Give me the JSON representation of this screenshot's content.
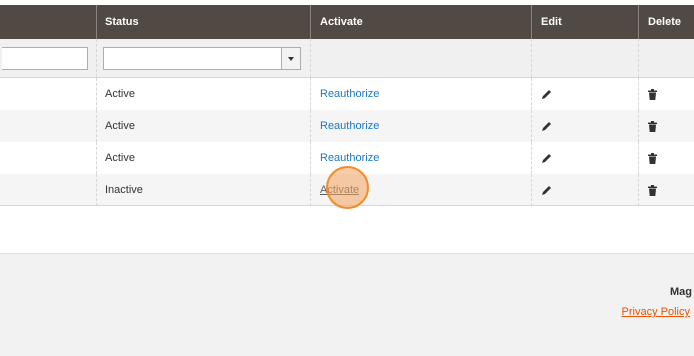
{
  "grid": {
    "columns": [
      {
        "key": "name",
        "label": ""
      },
      {
        "key": "status",
        "label": "Status"
      },
      {
        "key": "activate",
        "label": "Activate"
      },
      {
        "key": "edit",
        "label": "Edit"
      },
      {
        "key": "delete",
        "label": "Delete"
      }
    ],
    "filters": {
      "name_value": "",
      "status_selected": ""
    },
    "rows": [
      {
        "status": "Active",
        "activate": "Reauthorize"
      },
      {
        "status": "Active",
        "activate": "Reauthorize"
      },
      {
        "status": "Active",
        "activate": "Reauthorize"
      },
      {
        "status": "Inactive",
        "activate": "Activate"
      }
    ]
  },
  "footer": {
    "brand_text": "Mag",
    "privacy_link": "Privacy Policy"
  },
  "icons": {
    "edit": "pencil-icon",
    "delete": "trash-icon",
    "select_arrow": "chevron-down-icon"
  },
  "colors": {
    "header_bg": "#514943",
    "link": "#1979c3",
    "footer_link": "#eb5202",
    "click_highlight": "#f28c28"
  }
}
